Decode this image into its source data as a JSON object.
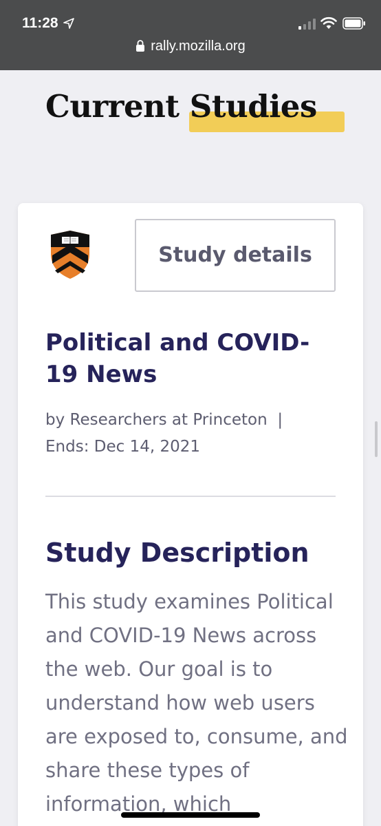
{
  "status_bar": {
    "time": "11:28",
    "url": "rally.mozilla.org"
  },
  "page": {
    "title": "Current Studies",
    "highlight_color": "#f2cd57"
  },
  "study": {
    "logo": "princeton-shield-icon",
    "details_button": "Study details",
    "title": "Political and COVID-19 News",
    "byline": "by Researchers at Princeton",
    "separator": "|",
    "ends": "Ends: Dec 14, 2021",
    "description_heading": "Study Description",
    "description": "This study examines Political and COVID-19 News across the web. Our goal is to understand how web users are exposed to, consume, and share these types of information, which"
  }
}
